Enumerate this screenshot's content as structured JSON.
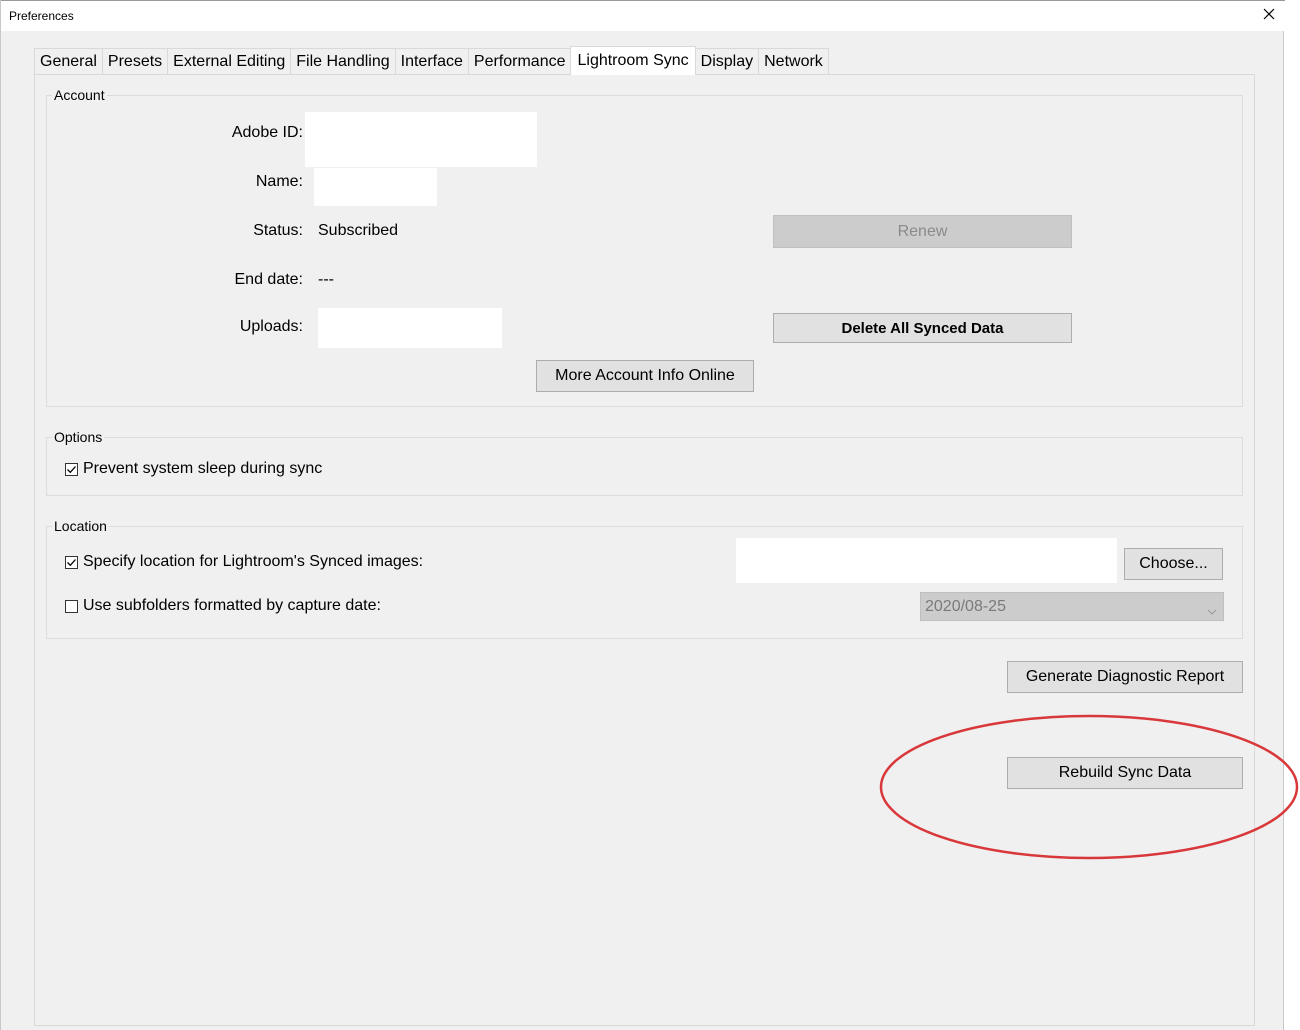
{
  "window": {
    "title": "Preferences",
    "close_icon": "close-icon"
  },
  "tabs": [
    {
      "label": "General"
    },
    {
      "label": "Presets"
    },
    {
      "label": "External Editing"
    },
    {
      "label": "File Handling"
    },
    {
      "label": "Interface"
    },
    {
      "label": "Performance"
    },
    {
      "label": "Lightroom Sync",
      "active": true
    },
    {
      "label": "Display"
    },
    {
      "label": "Network"
    }
  ],
  "account": {
    "group_label": "Account",
    "adobe_id_label": "Adobe ID:",
    "adobe_id_value": "",
    "name_label": "Name:",
    "name_value": "",
    "status_label": "Status:",
    "status_value": "Subscribed",
    "end_date_label": "End date:",
    "end_date_value": "---",
    "uploads_label": "Uploads:",
    "uploads_value": "",
    "renew_label": "Renew",
    "delete_label": "Delete All Synced Data",
    "more_info_label": "More Account Info Online"
  },
  "options": {
    "group_label": "Options",
    "prevent_sleep_label": "Prevent system sleep during sync",
    "prevent_sleep_checked": true
  },
  "location": {
    "group_label": "Location",
    "specify_label": "Specify location for Lightroom's Synced images:",
    "specify_checked": true,
    "path_value": "",
    "choose_label": "Choose...",
    "subfolders_label": "Use subfolders formatted by capture date:",
    "subfolders_checked": false,
    "date_format_value": "2020/08-25"
  },
  "actions": {
    "diagnostic_label": "Generate Diagnostic Report",
    "rebuild_label": "Rebuild Sync Data"
  },
  "annotation": {
    "color": "#d9383a"
  },
  "colors": {
    "window_bg": "#f0f0f0",
    "button_bg": "#e1e1e1",
    "disabled_bg": "#cccccc"
  }
}
